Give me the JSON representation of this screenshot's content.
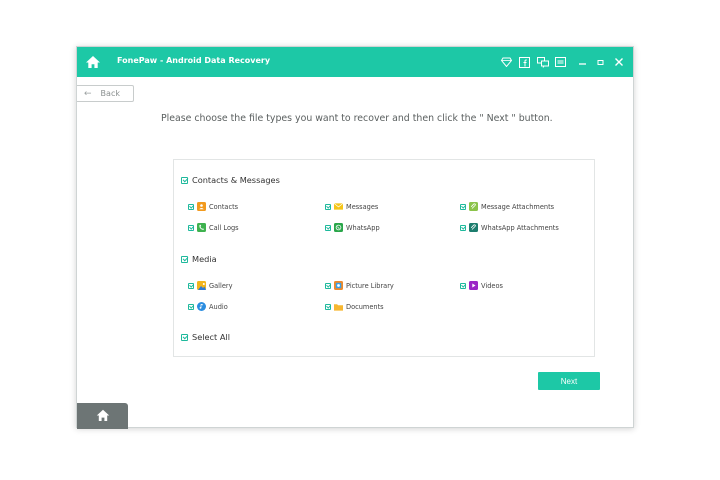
{
  "window": {
    "title": "FonePaw - Android Data Recovery",
    "titlebar_color": "#1dc8a6",
    "title_icons": [
      "diamond-icon",
      "facebook-icon",
      "chat-icon",
      "menu-icon",
      "minimize-icon",
      "restore-icon",
      "close-icon"
    ],
    "restore_glyph": "▫",
    "close_glyph": "✕"
  },
  "back_button": {
    "arrow": "←",
    "label": "Back"
  },
  "instruction": "Please choose the file types you want to recover and then click the \" Next \" button.",
  "groups": {
    "contacts_messages": {
      "label": "Contacts & Messages",
      "items": [
        {
          "label": "Contacts",
          "icon": "contacts-icon",
          "color": "#f29a1d"
        },
        {
          "label": "Messages",
          "icon": "envelope-icon",
          "color": "#f5c518"
        },
        {
          "label": "Message Attachments",
          "icon": "paperclip-icon",
          "color": "#8bc34a"
        },
        {
          "label": "Call Logs",
          "icon": "phone-icon",
          "color": "#3fb24f"
        },
        {
          "label": "WhatsApp",
          "icon": "whatsapp-icon",
          "color": "#2aa64a"
        },
        {
          "label": "WhatsApp Attachments",
          "icon": "whatsapp-attachment-icon",
          "color": "#1d7d6e"
        }
      ]
    },
    "media": {
      "label": "Media",
      "items": [
        {
          "label": "Gallery",
          "icon": "gallery-icon",
          "color": "#f2b51d"
        },
        {
          "label": "Picture Library",
          "icon": "picture-library-icon",
          "color": "#ef8a2a"
        },
        {
          "label": "Videos",
          "icon": "video-icon",
          "color": "#9b27c6"
        },
        {
          "label": "Audio",
          "icon": "audio-icon",
          "color": "#2b8de0"
        },
        {
          "label": "Documents",
          "icon": "folder-icon",
          "color": "#f7b731"
        }
      ]
    }
  },
  "select_all": "Select All",
  "next_button": "Next",
  "accent_color": "#1dc8a6",
  "checkbox_color": "#1eb99c"
}
